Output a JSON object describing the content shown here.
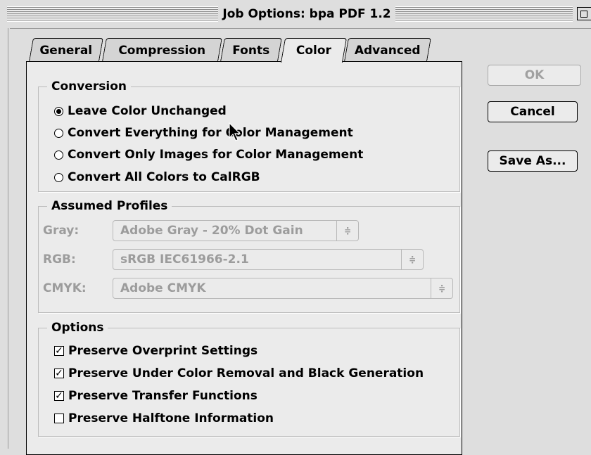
{
  "window": {
    "title": "Job Options: bpa PDF 1.2"
  },
  "tabs": [
    {
      "label": "General"
    },
    {
      "label": "Compression"
    },
    {
      "label": "Fonts"
    },
    {
      "label": "Color",
      "selected": true
    },
    {
      "label": "Advanced"
    }
  ],
  "conversion": {
    "legend": "Conversion",
    "options": [
      {
        "label": "Leave Color Unchanged",
        "selected": true
      },
      {
        "label": "Convert Everything for Color Management",
        "selected": false
      },
      {
        "label": "Convert Only Images for Color Management",
        "selected": false
      },
      {
        "label": "Convert All Colors to CalRGB",
        "selected": false
      }
    ]
  },
  "profiles": {
    "legend": "Assumed Profiles",
    "gray": {
      "label": "Gray:",
      "value": "Adobe Gray - 20% Dot Gain"
    },
    "rgb": {
      "label": "RGB:",
      "value": "sRGB IEC61966-2.1"
    },
    "cmyk": {
      "label": "CMYK:",
      "value": "Adobe CMYK"
    },
    "enabled": false
  },
  "options": {
    "legend": "Options",
    "items": [
      {
        "label": "Preserve Overprint Settings",
        "checked": true
      },
      {
        "label": "Preserve Under Color Removal and Black Generation",
        "checked": true
      },
      {
        "label": "Preserve Transfer Functions",
        "checked": true
      },
      {
        "label": "Preserve Halftone Information",
        "checked": false
      }
    ]
  },
  "buttons": {
    "ok": {
      "label": "OK",
      "enabled": false
    },
    "cancel": {
      "label": "Cancel"
    },
    "save_as": {
      "label": "Save As..."
    }
  },
  "icons": {
    "popup_arrows": "≑",
    "check_mark": "✓"
  }
}
